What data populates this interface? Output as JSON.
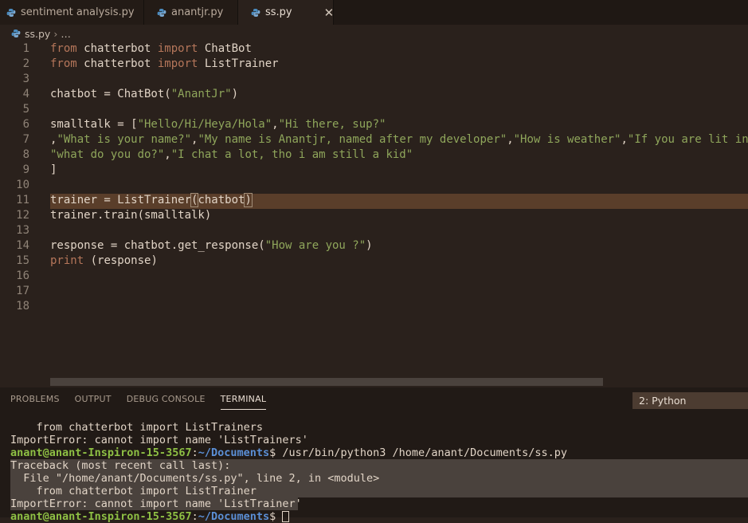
{
  "tabs": [
    {
      "label": "sentiment analysis.py"
    },
    {
      "label": "anantjr.py"
    },
    {
      "label": "ss.py",
      "close": "✕"
    }
  ],
  "breadcrumb": {
    "file": "ss.py",
    "sep": "›",
    "more": "…"
  },
  "editor": {
    "line_numbers": [
      "1",
      "2",
      "3",
      "4",
      "5",
      "6",
      "7",
      "8",
      "9",
      "10",
      "11",
      "12",
      "13",
      "14",
      "15",
      "16",
      "17",
      "18"
    ]
  },
  "panel": {
    "tabs": [
      "PROBLEMS",
      "OUTPUT",
      "DEBUG CONSOLE",
      "TERMINAL"
    ],
    "terminal_select": "2: Python",
    "lines": {
      "l1": "    from chatterbot import ListTrainers",
      "l2": "ImportError: cannot import name 'ListTrainers'",
      "prompt_user": "anant@anant-Inspiron-15-3567",
      "prompt_colon": ":",
      "prompt_path": "~/Documents",
      "prompt_cmd": "$ /usr/bin/python3 /home/anant/Documents/ss.py",
      "l4": "Traceback (most recent call last):",
      "l5": "  File \"/home/anant/Documents/ss.py\", line 2, in <module>",
      "l6": "    from chatterbot import ListTrainer",
      "l7": "ImportError: cannot import name 'ListTrainer'",
      "prompt_end": "$ "
    }
  },
  "colors": {
    "accent_user": "#8ec044",
    "accent_path": "#5b8fd6",
    "highlight_line": "#5a3e2a"
  }
}
